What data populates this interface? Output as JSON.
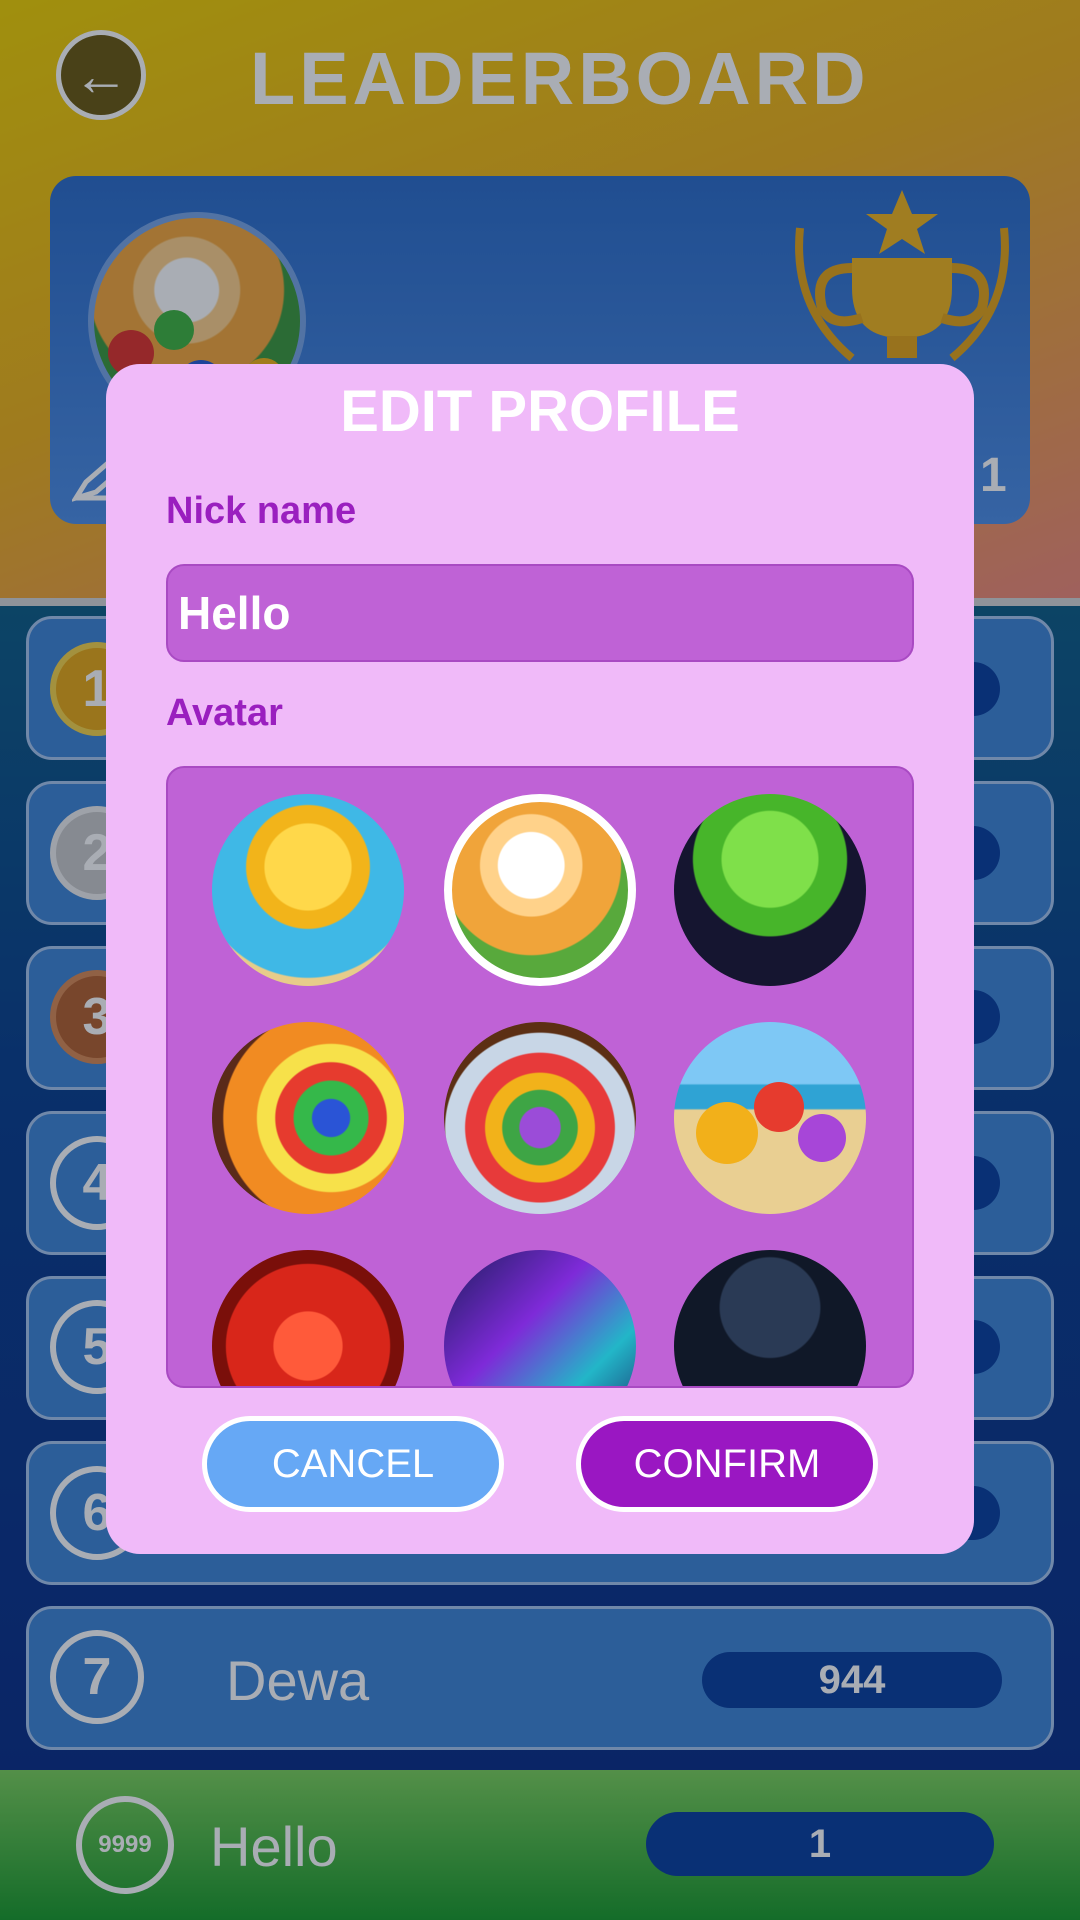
{
  "header": {
    "title": "LEADERBOARD",
    "back_glyph": "←"
  },
  "hero": {
    "rank": "1"
  },
  "rows": [
    {
      "rank": "1",
      "name": "",
      "score": ""
    },
    {
      "rank": "2",
      "name": "",
      "score": ""
    },
    {
      "rank": "3",
      "name": "",
      "score": ""
    },
    {
      "rank": "4",
      "name": "",
      "score": ""
    },
    {
      "rank": "5",
      "name": "",
      "score": ""
    },
    {
      "rank": "6",
      "name": "",
      "score": ""
    },
    {
      "rank": "7",
      "name": "Dewa",
      "score": "944"
    }
  ],
  "me": {
    "rank": "9999",
    "name": "Hello",
    "score": "1"
  },
  "dialog": {
    "title": "EDIT PROFILE",
    "nick_label": "Nick name",
    "nick_value": "Hello",
    "avatar_label": "Avatar",
    "avatars": [
      "duck-avatar",
      "kitten-avatar",
      "alien-avatar",
      "soccer-ball-avatar",
      "candy-jar-avatar",
      "beach-balls-avatar",
      "dog-avatar",
      "neon-track-avatar",
      "hooded-player-avatar"
    ],
    "selected_avatar": "kitten-avatar",
    "cancel_label": "CANCEL",
    "confirm_label": "CONFIRM"
  },
  "colors": {
    "dialog_bg": "#f0baf9",
    "panel": "#bf62d6",
    "accent": "#9a17c2",
    "cancel": "#66a8f5",
    "score_pill": "#0a3f9e"
  }
}
